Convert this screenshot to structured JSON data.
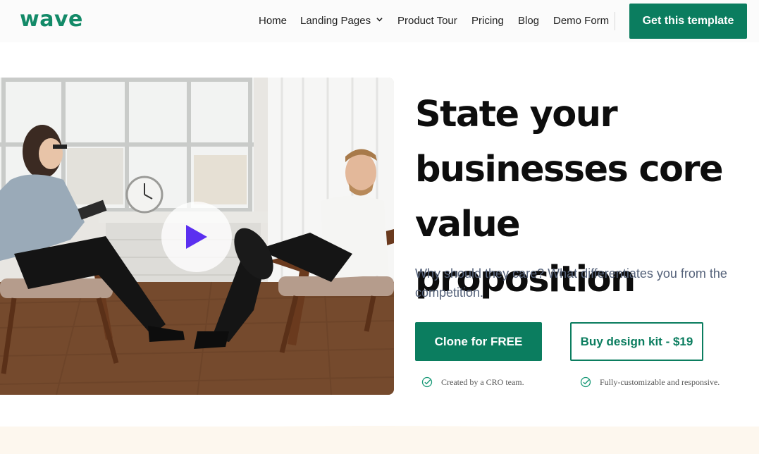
{
  "brand": {
    "logo_text": "wave",
    "accent": "#0b7d5f",
    "logo_color": "#138a68"
  },
  "nav": {
    "items": [
      {
        "label": "Home"
      },
      {
        "label": "Landing Pages",
        "has_dropdown": true,
        "icon": "chevron-down-icon"
      },
      {
        "label": "Product Tour"
      },
      {
        "label": "Pricing"
      },
      {
        "label": "Blog"
      },
      {
        "label": "Demo Form"
      }
    ],
    "cta_label": "Get this template"
  },
  "hero": {
    "image_icon": "play-icon",
    "headline": "State your businesses core value proposition",
    "subtext": "Why should they care? What differentiates you from the competition.",
    "primary_button": "Clone for FREE",
    "secondary_button": "Buy design kit - $19",
    "features": [
      {
        "icon": "check-circle-icon",
        "text": "Created by a CRO team."
      },
      {
        "icon": "check-circle-icon",
        "text": "Fully-customizable and responsive."
      }
    ]
  }
}
